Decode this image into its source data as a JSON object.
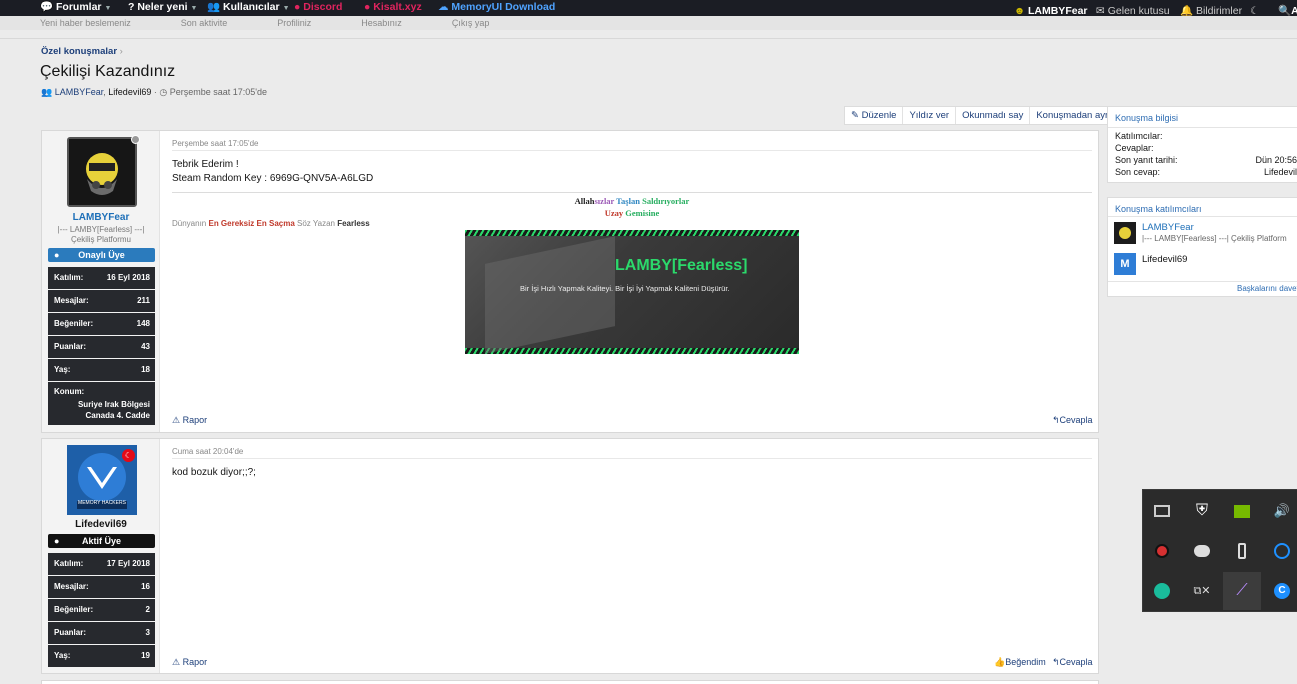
{
  "topnav": {
    "forumlar": "Forumlar",
    "neler_yeni": "Neler yeni",
    "kullanicilar": "Kullanıcılar",
    "discord": "Discord",
    "kisalt": "Kisalt.xyz",
    "memory": "MemoryUI Download",
    "user": "LAMBYFear",
    "inbox": "Gelen kutusu",
    "alerts": "Bildirimler",
    "search": "A"
  },
  "subnav": [
    "Yeni haber beslemeniz",
    "Son aktivite",
    "Profiliniz",
    "Hesabınız",
    "Çıkış yap"
  ],
  "breadcrumb": "Özel konuşmalar",
  "page_title": "Çekilişi Kazandınız",
  "meta": {
    "user1": "LAMBYFear",
    "sep": ",",
    "user2": "Lifedevil69",
    "date": "Perşembe saat 17:05'de"
  },
  "actions": {
    "edit": "Düzenle",
    "star": "Yıldız ver",
    "unread": "Okunmadı say",
    "leave": "Konuşmadan ayrıl"
  },
  "post1": {
    "date": "Perşembe saat 17:05'de",
    "line1": "Tebrik Ederim !",
    "line2": "Steam Random Key : 6969G-QNV5A-A6LGD",
    "user": {
      "name": "LAMBYFear",
      "title1": "|--- LAMBY[Fearless] ---|",
      "title2": "Çekiliş Platformu",
      "badge": "Onaylı Üye"
    },
    "stats": [
      {
        "k": "Katılım:",
        "v": "16 Eyl 2018"
      },
      {
        "k": "Mesajlar:",
        "v": "211"
      },
      {
        "k": "Beğeniler:",
        "v": "148"
      },
      {
        "k": "Puanlar:",
        "v": "43"
      },
      {
        "k": "Yaş:",
        "v": "18"
      }
    ],
    "location_label": "Konum:",
    "location": "Suriye Irak Bölgesi Canada 4. Cadde",
    "sig": {
      "l1a": "Allah",
      "l1b": "sızlar",
      "l1c": "Taşlan",
      "l1d": "Saldırıyorlar",
      "l2a": "Uzay",
      "l2b": "Gemisine",
      "l3a": "Dünyanın",
      "l3b": "En Gereksiz",
      "l3c": "En Saçma",
      "l3d": "Söz Yazan",
      "l3e": "Fearless",
      "banner_title": "LAMBY[Fearless]",
      "banner_sub": "Bir İşi Hızlı Yapmak Kaliteyi. Bir İşi İyi Yapmak Kaliteni Düşürür."
    },
    "report": "Rapor",
    "reply": "Cevapla"
  },
  "post2": {
    "date": "Cuma saat 20:04'de",
    "text": "kod bozuk diyor;;?;",
    "user": {
      "name": "Lifedevil69",
      "badge": "Aktif Üye",
      "avatar_text": "MEMORY HACKERS"
    },
    "stats": [
      {
        "k": "Katılım:",
        "v": "17 Eyl 2018"
      },
      {
        "k": "Mesajlar:",
        "v": "16"
      },
      {
        "k": "Beğeniler:",
        "v": "2"
      },
      {
        "k": "Puanlar:",
        "v": "3"
      },
      {
        "k": "Yaş:",
        "v": "19"
      }
    ],
    "report": "Rapor",
    "like": "Beğendim",
    "reply": "Cevapla"
  },
  "side1": {
    "title": "Konuşma bilgisi",
    "rows": [
      {
        "k": "Katılımcılar:",
        "v": ""
      },
      {
        "k": "Cevaplar:",
        "v": ""
      },
      {
        "k": "Son yanıt tarihi:",
        "v": "Dün 20:56"
      },
      {
        "k": "Son cevap:",
        "v": "Lifedevil"
      }
    ]
  },
  "side2": {
    "title": "Konuşma katılımcıları",
    "p1": "LAMBYFear",
    "p1t": "|--- LAMBY[Fearless] ---| Çekiliş Platform",
    "p2": "Lifedevil69",
    "more": "Başkalarını davet"
  },
  "colors": {
    "topbar": "#1b1d24",
    "link": "#1d3f7a",
    "discord": "#e0245e",
    "banner_green": "#2bd96b"
  }
}
